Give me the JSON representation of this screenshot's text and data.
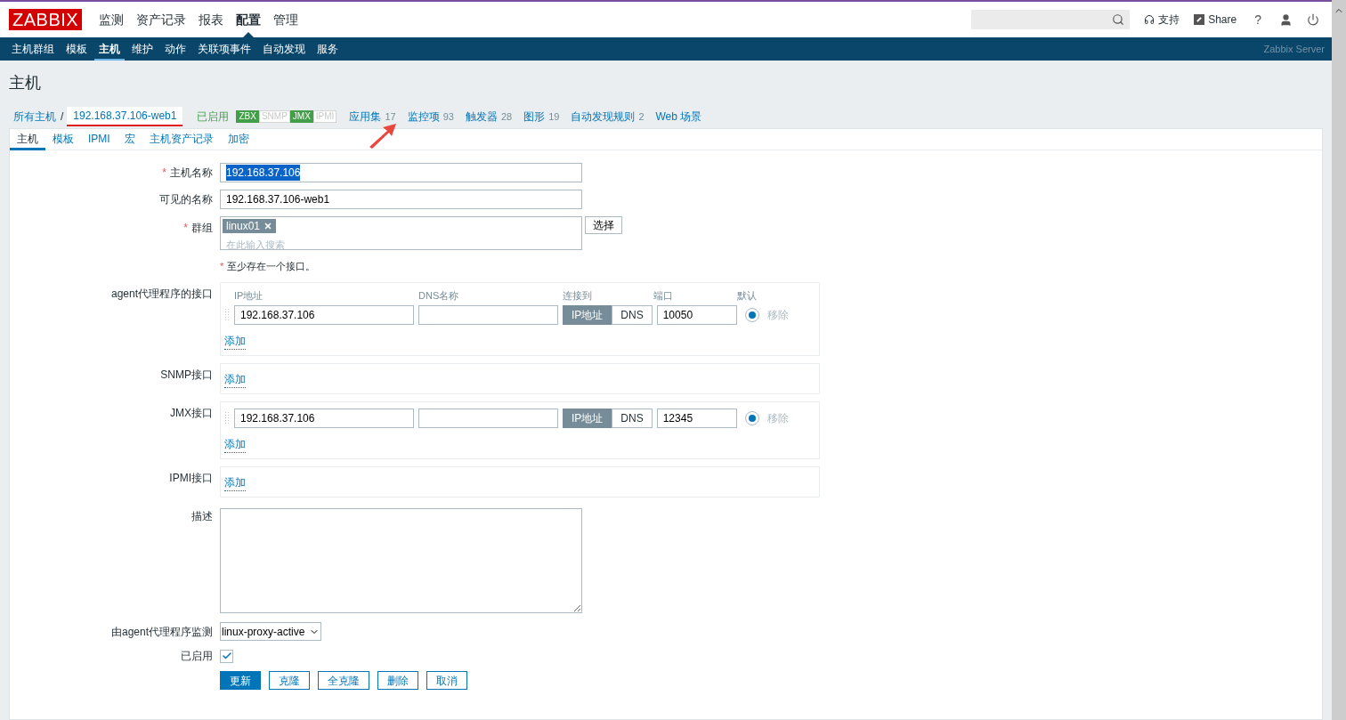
{
  "header": {
    "logo": "ZABBIX",
    "menu": [
      {
        "label": "监测",
        "selected": false
      },
      {
        "label": "资产记录",
        "selected": false
      },
      {
        "label": "报表",
        "selected": false
      },
      {
        "label": "配置",
        "selected": true
      },
      {
        "label": "管理",
        "selected": false
      }
    ],
    "support": "支持",
    "share": "Share",
    "help": "?"
  },
  "subnav": {
    "items": [
      {
        "label": "主机群组",
        "selected": false
      },
      {
        "label": "模板",
        "selected": false
      },
      {
        "label": "主机",
        "selected": true
      },
      {
        "label": "维护",
        "selected": false
      },
      {
        "label": "动作",
        "selected": false
      },
      {
        "label": "关联项事件",
        "selected": false
      },
      {
        "label": "自动发现",
        "selected": false
      },
      {
        "label": "服务",
        "selected": false
      }
    ],
    "server": "Zabbix Server"
  },
  "page_title": "主机",
  "breadcrumb": {
    "root": "所有主机",
    "separator": "/",
    "current": "192.168.37.106-web1",
    "status": "已启用",
    "availability": [
      {
        "label": "ZBX",
        "available": true
      },
      {
        "label": "SNMP",
        "available": false
      },
      {
        "label": "JMX",
        "available": true
      },
      {
        "label": "IPMI",
        "available": false
      }
    ],
    "links": [
      {
        "label": "应用集",
        "count": "17"
      },
      {
        "label": "监控项",
        "count": "93"
      },
      {
        "label": "触发器",
        "count": "28"
      },
      {
        "label": "图形",
        "count": "19"
      },
      {
        "label": "自动发现规则",
        "count": "2"
      },
      {
        "label": "Web 场景"
      }
    ]
  },
  "tabs": [
    {
      "label": "主机",
      "selected": true
    },
    {
      "label": "模板",
      "selected": false
    },
    {
      "label": "IPMI",
      "selected": false
    },
    {
      "label": "宏",
      "selected": false
    },
    {
      "label": "主机资产记录",
      "selected": false
    },
    {
      "label": "加密",
      "selected": false
    }
  ],
  "form": {
    "host_name": {
      "label": "主机名称",
      "required": true,
      "value": "192.168.37.106"
    },
    "visible_name": {
      "label": "可见的名称",
      "required": false,
      "value": "192.168.37.106-web1"
    },
    "groups": {
      "label": "群组",
      "required": true,
      "tags": [
        "linux01"
      ],
      "placeholder": "在此输入搜索",
      "select": "选择"
    },
    "required_mark": "*",
    "note": "至少存在一个接口。",
    "interfaces": [
      {
        "label": "agent代理程序的接口",
        "columns": [
          "IP地址",
          "DNS名称",
          "连接到",
          "端口",
          "默认"
        ],
        "rows": [
          {
            "ip": "192.168.37.106",
            "dns": "",
            "connect": [
              {
                "label": "IP地址",
                "selected": true
              },
              {
                "label": "DNS",
                "selected": false
              }
            ],
            "port": "10050",
            "default": true,
            "remove": "移除"
          }
        ],
        "add": "添加"
      },
      {
        "label": "SNMP接口",
        "add": "添加"
      },
      {
        "label": "JMX接口",
        "rows": [
          {
            "ip": "192.168.37.106",
            "dns": "",
            "connect": [
              {
                "label": "IP地址",
                "selected": true
              },
              {
                "label": "DNS",
                "selected": false
              }
            ],
            "port": "12345",
            "default": true,
            "remove": "移除"
          }
        ],
        "add": "添加"
      },
      {
        "label": "IPMI接口",
        "add": "添加"
      }
    ],
    "description": {
      "label": "描述"
    },
    "proxy": {
      "label": "由agent代理程序监测",
      "value": "linux-proxy-active"
    },
    "enabled": {
      "label": "已启用",
      "checked": true
    },
    "buttons": [
      {
        "label": "更新",
        "primary": true
      },
      {
        "label": "克隆",
        "primary": false
      },
      {
        "label": "全克隆",
        "primary": false
      },
      {
        "label": "删除",
        "primary": false
      },
      {
        "label": "取消",
        "primary": false
      }
    ]
  }
}
